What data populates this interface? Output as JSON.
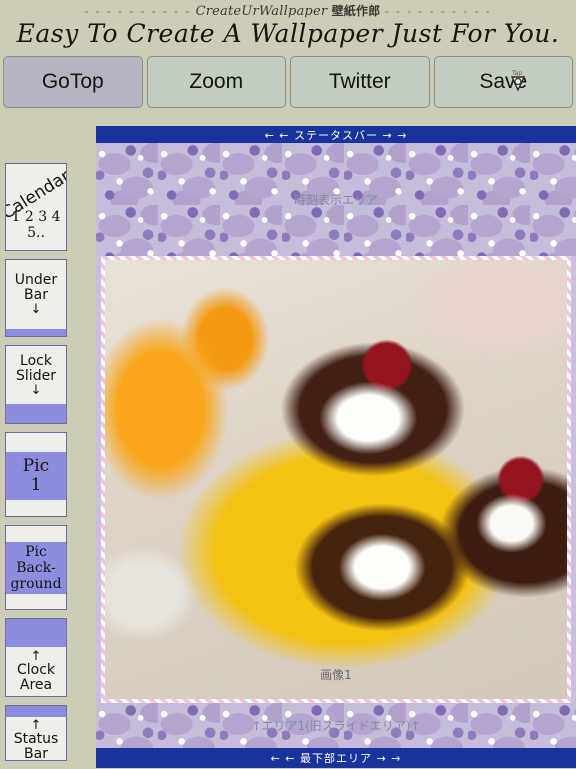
{
  "header": {
    "dash_left": "- - - - - - - - - -",
    "brand_en": "CreateUrWallpaper",
    "brand_jp": "壁紙作郎",
    "dash_right": "- - - - - - - - - -",
    "tagline": "Easy To Create A Wallpaper Just For You."
  },
  "toolbar": {
    "buttons": [
      {
        "label": "GoTop",
        "active": true
      },
      {
        "label": "Zoom",
        "active": false
      },
      {
        "label": "Twitter",
        "active": false
      },
      {
        "label": "Save",
        "active": false
      }
    ],
    "cursor_label": "Tap"
  },
  "sidebar": {
    "items": [
      {
        "name": "calendar",
        "label": "Calendar",
        "sub": "1 2 3 4 5.."
      },
      {
        "name": "under-bar",
        "label": "Under\nBar",
        "arrow": "↓"
      },
      {
        "name": "lock-slider",
        "label": "Lock\nSlider",
        "arrow": "↓"
      },
      {
        "name": "pic-1",
        "label": "Pic\n1"
      },
      {
        "name": "pic-background",
        "label": "Pic\nBack-\nground"
      },
      {
        "name": "clock-area",
        "label": "Clock\nArea",
        "arrow": "↑"
      },
      {
        "name": "status-bar",
        "label": "Status\nBar",
        "arrow": "↑"
      }
    ],
    "line": {
      "calendar_l1": "Calendar",
      "calendar_l2": "1 2 3 4 5..",
      "underbar_l1": "Under",
      "underbar_l2": "Bar",
      "underbar_arrow": "↓",
      "lockslider_l1": "Lock",
      "lockslider_l2": "Slider",
      "lockslider_arrow": "↓",
      "pic1_l1": "Pic",
      "pic1_l2": "1",
      "picbg_l1": "Pic",
      "picbg_l2": "Back-",
      "picbg_l3": "ground",
      "clock_arrow": "↑",
      "clock_l1": "Clock",
      "clock_l2": "Area",
      "status_arrow": "↑",
      "status_l1": "Status",
      "status_l2": "Bar"
    }
  },
  "preview": {
    "status_bar_label": "← ← ステータスバー → →",
    "clock_area_label": "時刻表示エリア",
    "photo_caption": "画像1",
    "slide_area_label": "↑エリア1(旧スライドエリア)↑",
    "bottom_bar_label": "← ← 最下部エリア → →"
  },
  "colors": {
    "page_background": "#ccccb7",
    "toolbar_active": "#b6b4c2",
    "toolbar_idle": "#c2cfc0",
    "sidebar_accent": "#8d8de0",
    "sidebar_face": "#eeeeea",
    "bar_blue": "#18339c",
    "wallpaper_lavender": "#c7bcd9"
  }
}
